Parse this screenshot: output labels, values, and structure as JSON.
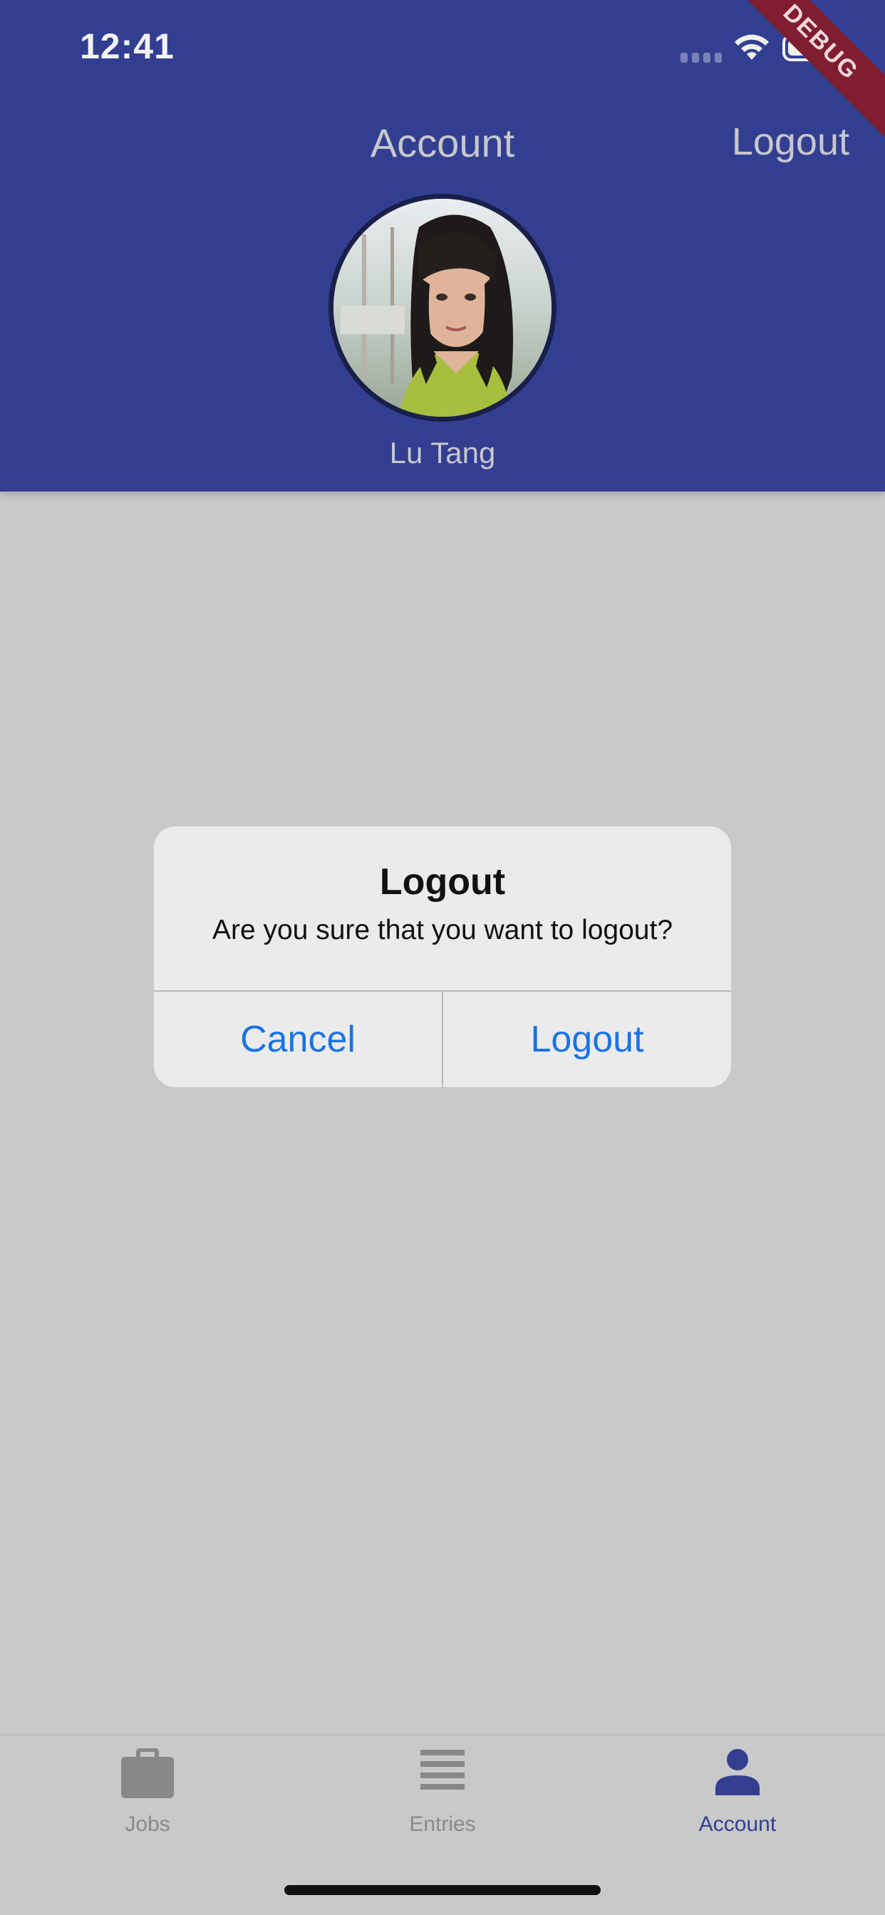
{
  "status_bar": {
    "time": "12:41"
  },
  "debug_banner": "DEBUG",
  "header": {
    "title": "Account",
    "logout_label": "Logout",
    "user_name": "Lu Tang"
  },
  "dialog": {
    "title": "Logout",
    "message": "Are you sure that you want to logout?",
    "cancel_label": "Cancel",
    "confirm_label": "Logout"
  },
  "bottom_nav": {
    "items": [
      {
        "label": "Jobs",
        "icon": "briefcase-icon",
        "active": false
      },
      {
        "label": "Entries",
        "icon": "list-icon",
        "active": false
      },
      {
        "label": "Account",
        "icon": "person-icon",
        "active": true
      }
    ]
  },
  "colors": {
    "app_bar": "#323f91",
    "accent_active": "#323f91",
    "dialog_action": "#1a73e6",
    "scrim_background": "#c9c9c9"
  }
}
